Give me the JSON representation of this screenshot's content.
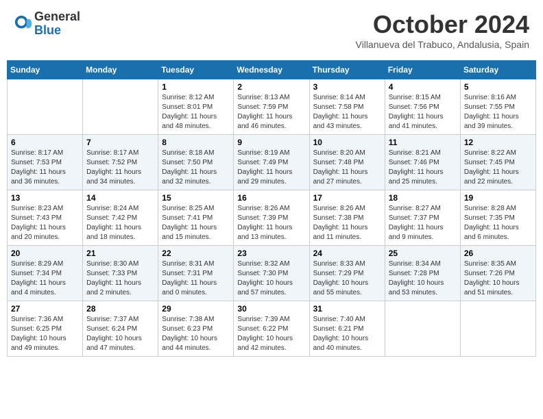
{
  "logo": {
    "general": "General",
    "blue": "Blue"
  },
  "title": "October 2024",
  "location": "Villanueva del Trabuco, Andalusia, Spain",
  "days_of_week": [
    "Sunday",
    "Monday",
    "Tuesday",
    "Wednesday",
    "Thursday",
    "Friday",
    "Saturday"
  ],
  "weeks": [
    [
      {
        "day": "",
        "info": ""
      },
      {
        "day": "",
        "info": ""
      },
      {
        "day": "1",
        "info": "Sunrise: 8:12 AM\nSunset: 8:01 PM\nDaylight: 11 hours and 48 minutes."
      },
      {
        "day": "2",
        "info": "Sunrise: 8:13 AM\nSunset: 7:59 PM\nDaylight: 11 hours and 46 minutes."
      },
      {
        "day": "3",
        "info": "Sunrise: 8:14 AM\nSunset: 7:58 PM\nDaylight: 11 hours and 43 minutes."
      },
      {
        "day": "4",
        "info": "Sunrise: 8:15 AM\nSunset: 7:56 PM\nDaylight: 11 hours and 41 minutes."
      },
      {
        "day": "5",
        "info": "Sunrise: 8:16 AM\nSunset: 7:55 PM\nDaylight: 11 hours and 39 minutes."
      }
    ],
    [
      {
        "day": "6",
        "info": "Sunrise: 8:17 AM\nSunset: 7:53 PM\nDaylight: 11 hours and 36 minutes."
      },
      {
        "day": "7",
        "info": "Sunrise: 8:17 AM\nSunset: 7:52 PM\nDaylight: 11 hours and 34 minutes."
      },
      {
        "day": "8",
        "info": "Sunrise: 8:18 AM\nSunset: 7:50 PM\nDaylight: 11 hours and 32 minutes."
      },
      {
        "day": "9",
        "info": "Sunrise: 8:19 AM\nSunset: 7:49 PM\nDaylight: 11 hours and 29 minutes."
      },
      {
        "day": "10",
        "info": "Sunrise: 8:20 AM\nSunset: 7:48 PM\nDaylight: 11 hours and 27 minutes."
      },
      {
        "day": "11",
        "info": "Sunrise: 8:21 AM\nSunset: 7:46 PM\nDaylight: 11 hours and 25 minutes."
      },
      {
        "day": "12",
        "info": "Sunrise: 8:22 AM\nSunset: 7:45 PM\nDaylight: 11 hours and 22 minutes."
      }
    ],
    [
      {
        "day": "13",
        "info": "Sunrise: 8:23 AM\nSunset: 7:43 PM\nDaylight: 11 hours and 20 minutes."
      },
      {
        "day": "14",
        "info": "Sunrise: 8:24 AM\nSunset: 7:42 PM\nDaylight: 11 hours and 18 minutes."
      },
      {
        "day": "15",
        "info": "Sunrise: 8:25 AM\nSunset: 7:41 PM\nDaylight: 11 hours and 15 minutes."
      },
      {
        "day": "16",
        "info": "Sunrise: 8:26 AM\nSunset: 7:39 PM\nDaylight: 11 hours and 13 minutes."
      },
      {
        "day": "17",
        "info": "Sunrise: 8:26 AM\nSunset: 7:38 PM\nDaylight: 11 hours and 11 minutes."
      },
      {
        "day": "18",
        "info": "Sunrise: 8:27 AM\nSunset: 7:37 PM\nDaylight: 11 hours and 9 minutes."
      },
      {
        "day": "19",
        "info": "Sunrise: 8:28 AM\nSunset: 7:35 PM\nDaylight: 11 hours and 6 minutes."
      }
    ],
    [
      {
        "day": "20",
        "info": "Sunrise: 8:29 AM\nSunset: 7:34 PM\nDaylight: 11 hours and 4 minutes."
      },
      {
        "day": "21",
        "info": "Sunrise: 8:30 AM\nSunset: 7:33 PM\nDaylight: 11 hours and 2 minutes."
      },
      {
        "day": "22",
        "info": "Sunrise: 8:31 AM\nSunset: 7:31 PM\nDaylight: 11 hours and 0 minutes."
      },
      {
        "day": "23",
        "info": "Sunrise: 8:32 AM\nSunset: 7:30 PM\nDaylight: 10 hours and 57 minutes."
      },
      {
        "day": "24",
        "info": "Sunrise: 8:33 AM\nSunset: 7:29 PM\nDaylight: 10 hours and 55 minutes."
      },
      {
        "day": "25",
        "info": "Sunrise: 8:34 AM\nSunset: 7:28 PM\nDaylight: 10 hours and 53 minutes."
      },
      {
        "day": "26",
        "info": "Sunrise: 8:35 AM\nSunset: 7:26 PM\nDaylight: 10 hours and 51 minutes."
      }
    ],
    [
      {
        "day": "27",
        "info": "Sunrise: 7:36 AM\nSunset: 6:25 PM\nDaylight: 10 hours and 49 minutes."
      },
      {
        "day": "28",
        "info": "Sunrise: 7:37 AM\nSunset: 6:24 PM\nDaylight: 10 hours and 47 minutes."
      },
      {
        "day": "29",
        "info": "Sunrise: 7:38 AM\nSunset: 6:23 PM\nDaylight: 10 hours and 44 minutes."
      },
      {
        "day": "30",
        "info": "Sunrise: 7:39 AM\nSunset: 6:22 PM\nDaylight: 10 hours and 42 minutes."
      },
      {
        "day": "31",
        "info": "Sunrise: 7:40 AM\nSunset: 6:21 PM\nDaylight: 10 hours and 40 minutes."
      },
      {
        "day": "",
        "info": ""
      },
      {
        "day": "",
        "info": ""
      }
    ]
  ]
}
